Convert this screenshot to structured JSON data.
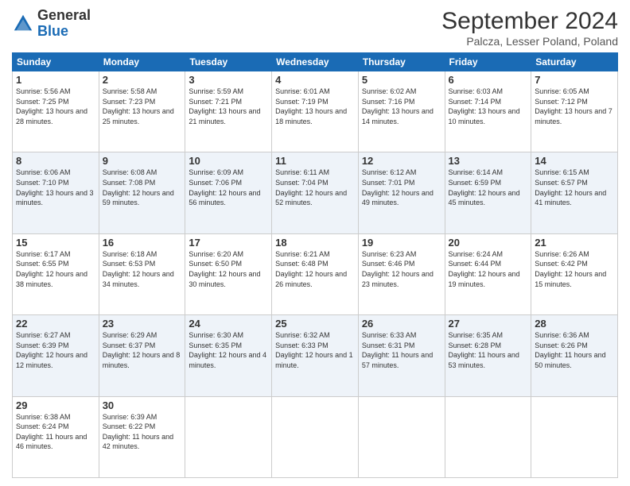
{
  "header": {
    "logo_general": "General",
    "logo_blue": "Blue",
    "month": "September 2024",
    "location": "Palcza, Lesser Poland, Poland"
  },
  "days_of_week": [
    "Sunday",
    "Monday",
    "Tuesday",
    "Wednesday",
    "Thursday",
    "Friday",
    "Saturday"
  ],
  "weeks": [
    [
      {
        "day": "1",
        "sunrise": "Sunrise: 5:56 AM",
        "sunset": "Sunset: 7:25 PM",
        "daylight": "Daylight: 13 hours and 28 minutes."
      },
      {
        "day": "2",
        "sunrise": "Sunrise: 5:58 AM",
        "sunset": "Sunset: 7:23 PM",
        "daylight": "Daylight: 13 hours and 25 minutes."
      },
      {
        "day": "3",
        "sunrise": "Sunrise: 5:59 AM",
        "sunset": "Sunset: 7:21 PM",
        "daylight": "Daylight: 13 hours and 21 minutes."
      },
      {
        "day": "4",
        "sunrise": "Sunrise: 6:01 AM",
        "sunset": "Sunset: 7:19 PM",
        "daylight": "Daylight: 13 hours and 18 minutes."
      },
      {
        "day": "5",
        "sunrise": "Sunrise: 6:02 AM",
        "sunset": "Sunset: 7:16 PM",
        "daylight": "Daylight: 13 hours and 14 minutes."
      },
      {
        "day": "6",
        "sunrise": "Sunrise: 6:03 AM",
        "sunset": "Sunset: 7:14 PM",
        "daylight": "Daylight: 13 hours and 10 minutes."
      },
      {
        "day": "7",
        "sunrise": "Sunrise: 6:05 AM",
        "sunset": "Sunset: 7:12 PM",
        "daylight": "Daylight: 13 hours and 7 minutes."
      }
    ],
    [
      {
        "day": "8",
        "sunrise": "Sunrise: 6:06 AM",
        "sunset": "Sunset: 7:10 PM",
        "daylight": "Daylight: 13 hours and 3 minutes."
      },
      {
        "day": "9",
        "sunrise": "Sunrise: 6:08 AM",
        "sunset": "Sunset: 7:08 PM",
        "daylight": "Daylight: 12 hours and 59 minutes."
      },
      {
        "day": "10",
        "sunrise": "Sunrise: 6:09 AM",
        "sunset": "Sunset: 7:06 PM",
        "daylight": "Daylight: 12 hours and 56 minutes."
      },
      {
        "day": "11",
        "sunrise": "Sunrise: 6:11 AM",
        "sunset": "Sunset: 7:04 PM",
        "daylight": "Daylight: 12 hours and 52 minutes."
      },
      {
        "day": "12",
        "sunrise": "Sunrise: 6:12 AM",
        "sunset": "Sunset: 7:01 PM",
        "daylight": "Daylight: 12 hours and 49 minutes."
      },
      {
        "day": "13",
        "sunrise": "Sunrise: 6:14 AM",
        "sunset": "Sunset: 6:59 PM",
        "daylight": "Daylight: 12 hours and 45 minutes."
      },
      {
        "day": "14",
        "sunrise": "Sunrise: 6:15 AM",
        "sunset": "Sunset: 6:57 PM",
        "daylight": "Daylight: 12 hours and 41 minutes."
      }
    ],
    [
      {
        "day": "15",
        "sunrise": "Sunrise: 6:17 AM",
        "sunset": "Sunset: 6:55 PM",
        "daylight": "Daylight: 12 hours and 38 minutes."
      },
      {
        "day": "16",
        "sunrise": "Sunrise: 6:18 AM",
        "sunset": "Sunset: 6:53 PM",
        "daylight": "Daylight: 12 hours and 34 minutes."
      },
      {
        "day": "17",
        "sunrise": "Sunrise: 6:20 AM",
        "sunset": "Sunset: 6:50 PM",
        "daylight": "Daylight: 12 hours and 30 minutes."
      },
      {
        "day": "18",
        "sunrise": "Sunrise: 6:21 AM",
        "sunset": "Sunset: 6:48 PM",
        "daylight": "Daylight: 12 hours and 26 minutes."
      },
      {
        "day": "19",
        "sunrise": "Sunrise: 6:23 AM",
        "sunset": "Sunset: 6:46 PM",
        "daylight": "Daylight: 12 hours and 23 minutes."
      },
      {
        "day": "20",
        "sunrise": "Sunrise: 6:24 AM",
        "sunset": "Sunset: 6:44 PM",
        "daylight": "Daylight: 12 hours and 19 minutes."
      },
      {
        "day": "21",
        "sunrise": "Sunrise: 6:26 AM",
        "sunset": "Sunset: 6:42 PM",
        "daylight": "Daylight: 12 hours and 15 minutes."
      }
    ],
    [
      {
        "day": "22",
        "sunrise": "Sunrise: 6:27 AM",
        "sunset": "Sunset: 6:39 PM",
        "daylight": "Daylight: 12 hours and 12 minutes."
      },
      {
        "day": "23",
        "sunrise": "Sunrise: 6:29 AM",
        "sunset": "Sunset: 6:37 PM",
        "daylight": "Daylight: 12 hours and 8 minutes."
      },
      {
        "day": "24",
        "sunrise": "Sunrise: 6:30 AM",
        "sunset": "Sunset: 6:35 PM",
        "daylight": "Daylight: 12 hours and 4 minutes."
      },
      {
        "day": "25",
        "sunrise": "Sunrise: 6:32 AM",
        "sunset": "Sunset: 6:33 PM",
        "daylight": "Daylight: 12 hours and 1 minute."
      },
      {
        "day": "26",
        "sunrise": "Sunrise: 6:33 AM",
        "sunset": "Sunset: 6:31 PM",
        "daylight": "Daylight: 11 hours and 57 minutes."
      },
      {
        "day": "27",
        "sunrise": "Sunrise: 6:35 AM",
        "sunset": "Sunset: 6:28 PM",
        "daylight": "Daylight: 11 hours and 53 minutes."
      },
      {
        "day": "28",
        "sunrise": "Sunrise: 6:36 AM",
        "sunset": "Sunset: 6:26 PM",
        "daylight": "Daylight: 11 hours and 50 minutes."
      }
    ],
    [
      {
        "day": "29",
        "sunrise": "Sunrise: 6:38 AM",
        "sunset": "Sunset: 6:24 PM",
        "daylight": "Daylight: 11 hours and 46 minutes."
      },
      {
        "day": "30",
        "sunrise": "Sunrise: 6:39 AM",
        "sunset": "Sunset: 6:22 PM",
        "daylight": "Daylight: 11 hours and 42 minutes."
      },
      {
        "day": "",
        "sunrise": "",
        "sunset": "",
        "daylight": ""
      },
      {
        "day": "",
        "sunrise": "",
        "sunset": "",
        "daylight": ""
      },
      {
        "day": "",
        "sunrise": "",
        "sunset": "",
        "daylight": ""
      },
      {
        "day": "",
        "sunrise": "",
        "sunset": "",
        "daylight": ""
      },
      {
        "day": "",
        "sunrise": "",
        "sunset": "",
        "daylight": ""
      }
    ]
  ]
}
